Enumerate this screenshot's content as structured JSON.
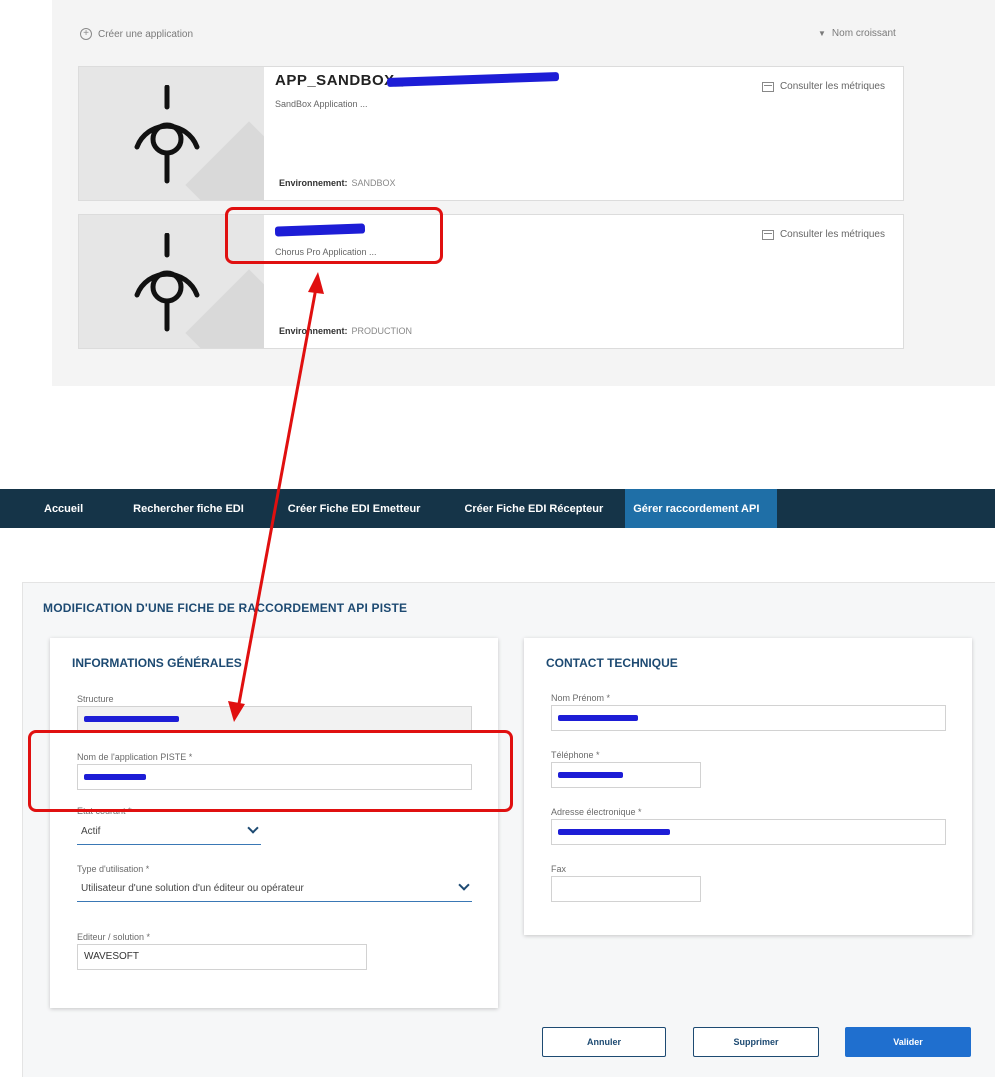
{
  "toolbar": {
    "create_label": "Créer une application",
    "sort_label": "Nom croissant",
    "plus_symbol": "+"
  },
  "apps": [
    {
      "title": "APP_SANDBOX_",
      "description": "SandBox Application ...",
      "env_label": "Environnement:",
      "env_value": "SANDBOX",
      "metrics_label": "Consulter les métriques"
    },
    {
      "title": "",
      "description": "Chorus Pro Application ...",
      "env_label": "Environnement:",
      "env_value": "PRODUCTION",
      "metrics_label": "Consulter les métriques"
    }
  ],
  "nav": {
    "items": [
      "Accueil",
      "Rechercher fiche EDI",
      "Créer Fiche EDI Emetteur",
      "Créer Fiche EDI Récepteur",
      "Gérer raccordement API"
    ],
    "active_index": 4
  },
  "form": {
    "page_title": "Modification d'une fiche de raccordement API PISTE",
    "general": {
      "title": "Informations générales",
      "structure_label": "Structure",
      "app_name_label": "Nom de l'application PISTE *",
      "state_label": "Etat courant *",
      "state_value": "Actif",
      "usage_label": "Type d'utilisation *",
      "usage_value": "Utilisateur d'une solution d'un éditeur ou opérateur",
      "editor_label": "Editeur / solution *",
      "editor_value": "WAVESOFT"
    },
    "contact": {
      "title": "Contact technique",
      "name_label": "Nom Prénom *",
      "phone_label": "Téléphone *",
      "email_label": "Adresse électronique *",
      "fax_label": "Fax"
    },
    "buttons": {
      "cancel": "Annuler",
      "delete": "Supprimer",
      "validate": "Valider"
    }
  },
  "colors": {
    "nav_bg": "#153448",
    "nav_active": "#1f6fa7",
    "heading": "#1d4a72",
    "primary_button": "#1f6fcf",
    "annotation": "#e01010",
    "redaction": "#1d1dd6"
  },
  "icons": {
    "app_icon": "antenna-pin-icon",
    "metrics_icon": "calendar-icon",
    "sort_icon": "chevron-down-icon",
    "create_icon": "plus-circle-icon"
  }
}
